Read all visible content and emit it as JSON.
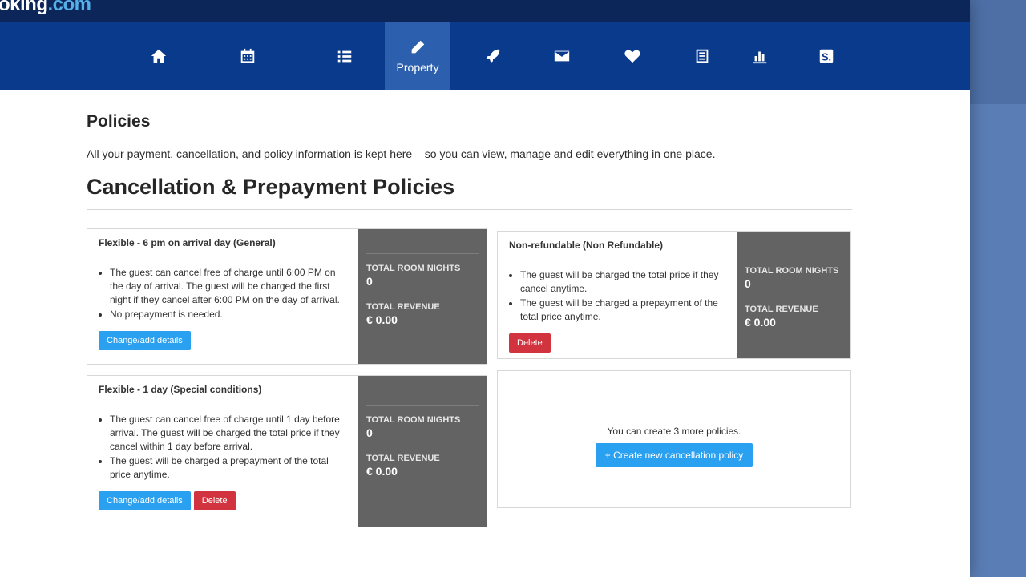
{
  "brand": {
    "name": "oking",
    "domain": ".com"
  },
  "nav": {
    "items": [
      {
        "icon": "home-icon",
        "label": ""
      },
      {
        "icon": "calendar-icon",
        "label": ""
      },
      {
        "icon": "list-icon",
        "label": ""
      },
      {
        "icon": "pencil-icon",
        "label": "Property"
      },
      {
        "icon": "rocket-icon",
        "label": ""
      },
      {
        "icon": "envelope-icon",
        "label": ""
      },
      {
        "icon": "heart-icon",
        "label": ""
      },
      {
        "icon": "document-icon",
        "label": ""
      },
      {
        "icon": "bar-chart-icon",
        "label": ""
      },
      {
        "icon": "s-logo-icon",
        "label": ""
      }
    ],
    "active": "Property"
  },
  "page": {
    "title": "Policies",
    "intro": "All your payment, cancellation, and policy information is kept here – so you can view, manage and edit everything in one place.",
    "section_title": "Cancellation & Prepayment Policies"
  },
  "policies": [
    {
      "title": "Flexible - 6 pm on arrival day (General)",
      "bullets": [
        "The guest can cancel free of charge until 6:00 PM on the day of arrival. The guest will be charged the first night if they cancel after 6:00 PM on the day of arrival.",
        "No prepayment is needed."
      ],
      "stats": {
        "nights_label": "TOTAL ROOM NIGHTS",
        "nights": "0",
        "revenue_label": "TOTAL REVENUE",
        "revenue": "€ 0.00"
      },
      "change_label": "Change/add details",
      "delete_label": ""
    },
    {
      "title": "Non-refundable (Non Refundable)",
      "bullets": [
        "The guest will be charged the total price if they cancel anytime.",
        "The guest will be charged a prepayment of the total price anytime."
      ],
      "stats": {
        "nights_label": "TOTAL ROOM NIGHTS",
        "nights": "0",
        "revenue_label": "TOTAL REVENUE",
        "revenue": "€ 0.00"
      },
      "change_label": "",
      "delete_label": "Delete"
    },
    {
      "title": "Flexible - 1 day (Special conditions)",
      "bullets": [
        "The guest can cancel free of charge until 1 day before arrival. The guest will be charged the total price if they cancel within 1 day before arrival.",
        "The guest will be charged a prepayment of the total price anytime."
      ],
      "stats": {
        "nights_label": "TOTAL ROOM NIGHTS",
        "nights": "0",
        "revenue_label": "TOTAL REVENUE",
        "revenue": "€ 0.00"
      },
      "change_label": "Change/add details",
      "delete_label": "Delete"
    }
  ],
  "create": {
    "text": "You can create 3 more policies.",
    "button_label": "+ Create new cancellation policy"
  },
  "colors": {
    "nav_bg": "#0a3a8c",
    "topbar_bg": "#0c2659",
    "active_nav": "#2c5fad",
    "stats_bg": "#636363",
    "primary_button": "#2aa0f0",
    "danger_button": "#d2343f"
  }
}
